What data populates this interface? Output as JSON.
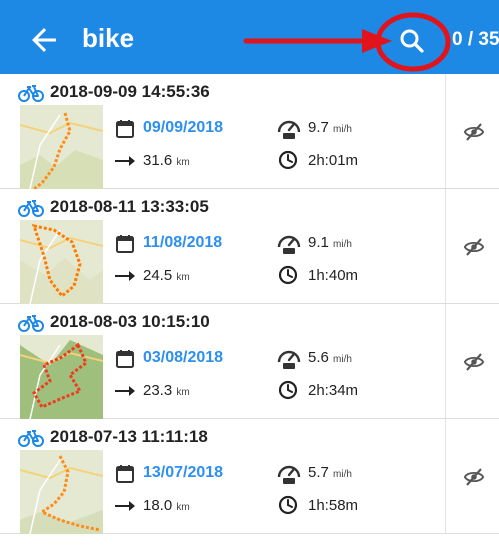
{
  "appbar": {
    "title": "bike",
    "counter": "0 / 35",
    "icons": {
      "back": "arrow-left-icon",
      "search": "search-icon"
    },
    "color": "#1e88e5"
  },
  "annotation": {
    "color": "#e0141a"
  },
  "tracks": [
    {
      "title": "2018-09-09 14:55:36",
      "date": "09/09/2018",
      "distance": "31.6",
      "distance_unit": "km",
      "speed": "9.7",
      "speed_unit": "mi/h",
      "duration": "2h:01m"
    },
    {
      "title": "2018-08-11 13:33:05",
      "date": "11/08/2018",
      "distance": "24.5",
      "distance_unit": "km",
      "speed": "9.1",
      "speed_unit": "mi/h",
      "duration": "1h:40m"
    },
    {
      "title": "2018-08-03 10:15:10",
      "date": "03/08/2018",
      "distance": "23.3",
      "distance_unit": "km",
      "speed": "5.6",
      "speed_unit": "mi/h",
      "duration": "2h:34m"
    },
    {
      "title": "2018-07-13 11:11:18",
      "date": "13/07/2018",
      "distance": "18.0",
      "distance_unit": "km",
      "speed": "5.7",
      "speed_unit": "mi/h",
      "duration": "1h:58m"
    }
  ],
  "row_icons": {
    "activity": "bicycle-icon",
    "date": "calendar-icon",
    "distance": "arrow-right-icon",
    "speed": "speedometer-icon",
    "duration": "clock-icon",
    "visibility": "eye-off-icon"
  },
  "colors": {
    "date_text": "#2d8ff0",
    "icon_blue": "#1e88e5"
  }
}
